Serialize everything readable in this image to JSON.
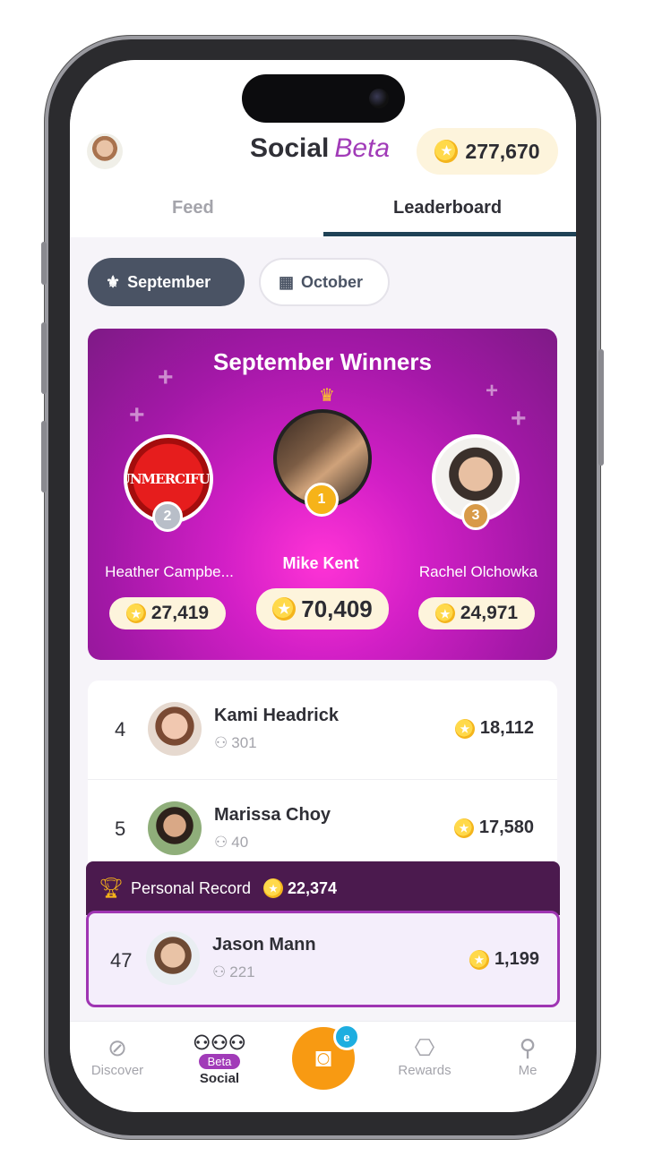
{
  "header": {
    "title": "Social",
    "title_badge": "Beta",
    "coins": "277,670",
    "tabs": [
      {
        "label": "Feed",
        "active": false
      },
      {
        "label": "Leaderboard",
        "active": true
      }
    ]
  },
  "months": [
    {
      "label": "September",
      "icon": "award-icon",
      "selected": true
    },
    {
      "label": "October",
      "icon": "calendar-icon",
      "selected": false
    }
  ],
  "winners": {
    "title": "September Winners",
    "first": {
      "name": "Mike Kent",
      "rank": "1",
      "score": "70,409"
    },
    "second": {
      "name": "Heather Campbe...",
      "rank": "2",
      "score": "27,419",
      "avatar_text": "UNMERCIFUL"
    },
    "third": {
      "name": "Rachel Olchowka",
      "rank": "3",
      "score": "24,971"
    }
  },
  "leaderboard": [
    {
      "rank": "4",
      "name": "Kami Headrick",
      "followers": "301",
      "score": "18,112"
    },
    {
      "rank": "5",
      "name": "Marissa Choy",
      "followers": "40",
      "score": "17,580"
    }
  ],
  "personal_record": {
    "label": "Personal Record",
    "value": "22,374"
  },
  "me": {
    "rank": "47",
    "name": "Jason Mann",
    "followers": "221",
    "score": "1,199"
  },
  "tabbar": {
    "discover": "Discover",
    "social": "Social",
    "social_badge": "Beta",
    "camera_badge": "e",
    "rewards": "Rewards",
    "me": "Me"
  },
  "colors": {
    "accent": "#a13bb8",
    "header_tab": "#1f4256",
    "coin": "#f4b51c",
    "camera": "#f89a12"
  }
}
